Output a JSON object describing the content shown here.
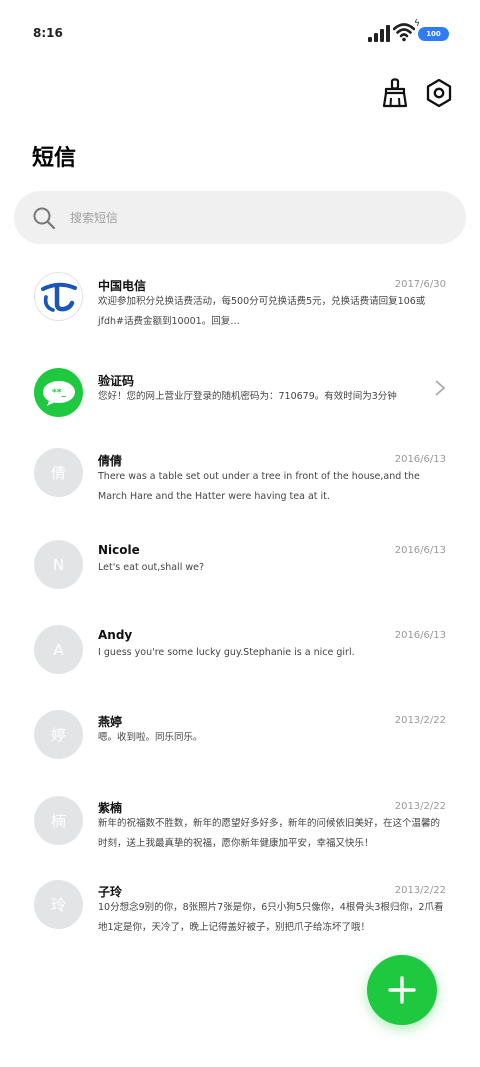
{
  "status_bar": {
    "time": "8:16",
    "battery": "100"
  },
  "header": {
    "title": "短信",
    "clean_icon": "broom-icon",
    "settings_icon": "settings-icon"
  },
  "search": {
    "placeholder": "搜索短信"
  },
  "messages": [
    {
      "sender": "中国电信",
      "date": "2017/6/30",
      "preview": "欢迎参加积分兑换话费活动，每500分可兑换话费5元，兑换话费请回复106或jfdh#话费金额到10001。回复…",
      "avatar_type": "telecom-logo"
    },
    {
      "sender": "验证码",
      "date": "",
      "preview": "您好！您的网上营业厅登录的随机密码为：710679。有效时间为3分钟",
      "avatar_type": "chat-bubble"
    },
    {
      "sender": "倩倩",
      "date": "2016/6/13",
      "preview": "There was a table set out under a tree in front of the house,and the March Hare and the Hatter were having tea at it.",
      "avatar_letter": "倩"
    },
    {
      "sender": "Nicole",
      "date": "2016/6/13",
      "preview": "Let's eat out,shall we?",
      "avatar_letter": "N"
    },
    {
      "sender": "Andy",
      "date": "2016/6/13",
      "preview": "I guess you're some lucky guy.Stephanie is a nice girl.",
      "avatar_letter": "A"
    },
    {
      "sender": "燕婷",
      "date": "2013/2/22",
      "preview": "嗯。收到啦。同乐同乐。",
      "avatar_letter": "婷"
    },
    {
      "sender": "紫楠",
      "date": "2013/2/22",
      "preview": "新年的祝福数不胜数，新年的愿望好多好多，新年的问候依旧美好，在这个温馨的时刻，送上我最真挚的祝福，愿你新年健康加平安，幸福又快乐！",
      "avatar_letter": "楠"
    },
    {
      "sender": "子玲",
      "date": "2013/2/22",
      "preview": "10分想念9别的你，8张照片7张是你，6只小狗5只像你，4根骨头3根归你，2爪看地1定是你，天冷了，晚上记得盖好被子，别把爪子给冻坏了哦！",
      "avatar_letter": "玲"
    }
  ],
  "colors": {
    "accent": "#1ec940",
    "battery": "#2f7bf5",
    "avatar_grey": "#e3e4e6"
  }
}
